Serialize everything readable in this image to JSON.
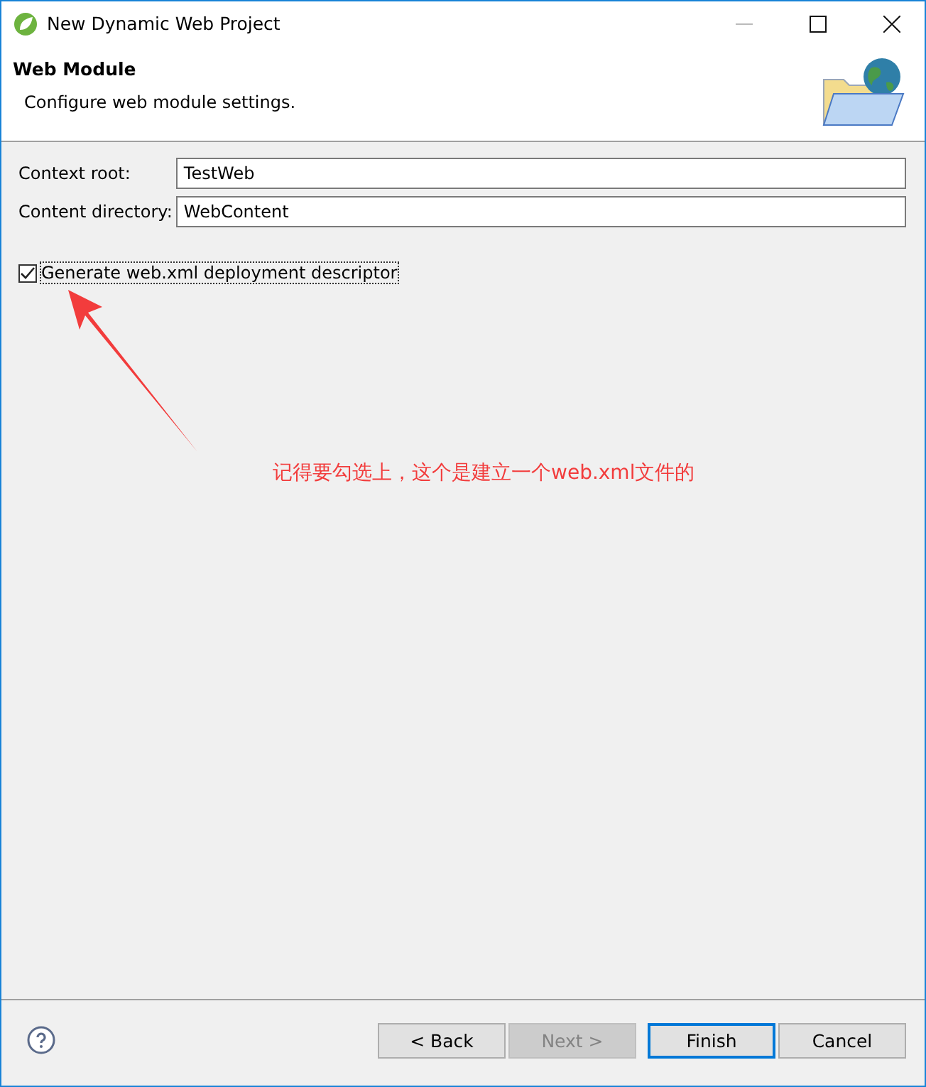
{
  "window": {
    "title": "New Dynamic Web Project"
  },
  "header": {
    "title": "Web Module",
    "description": "Configure web module settings."
  },
  "fields": [
    {
      "label": "Context root:",
      "value": "TestWeb"
    },
    {
      "label": "Content directory:",
      "value": "WebContent"
    }
  ],
  "checkbox": {
    "label": "Generate web.xml deployment descriptor",
    "checked": true
  },
  "annotation": {
    "text": "记得要勾选上，这个是建立一个web.xml文件的"
  },
  "buttons": [
    {
      "label": "< Back",
      "disabled": false,
      "default": false
    },
    {
      "label": "Next >",
      "disabled": true,
      "default": false
    },
    {
      "label": "Finish",
      "disabled": false,
      "default": true
    },
    {
      "label": "Cancel",
      "disabled": false,
      "default": false
    }
  ]
}
